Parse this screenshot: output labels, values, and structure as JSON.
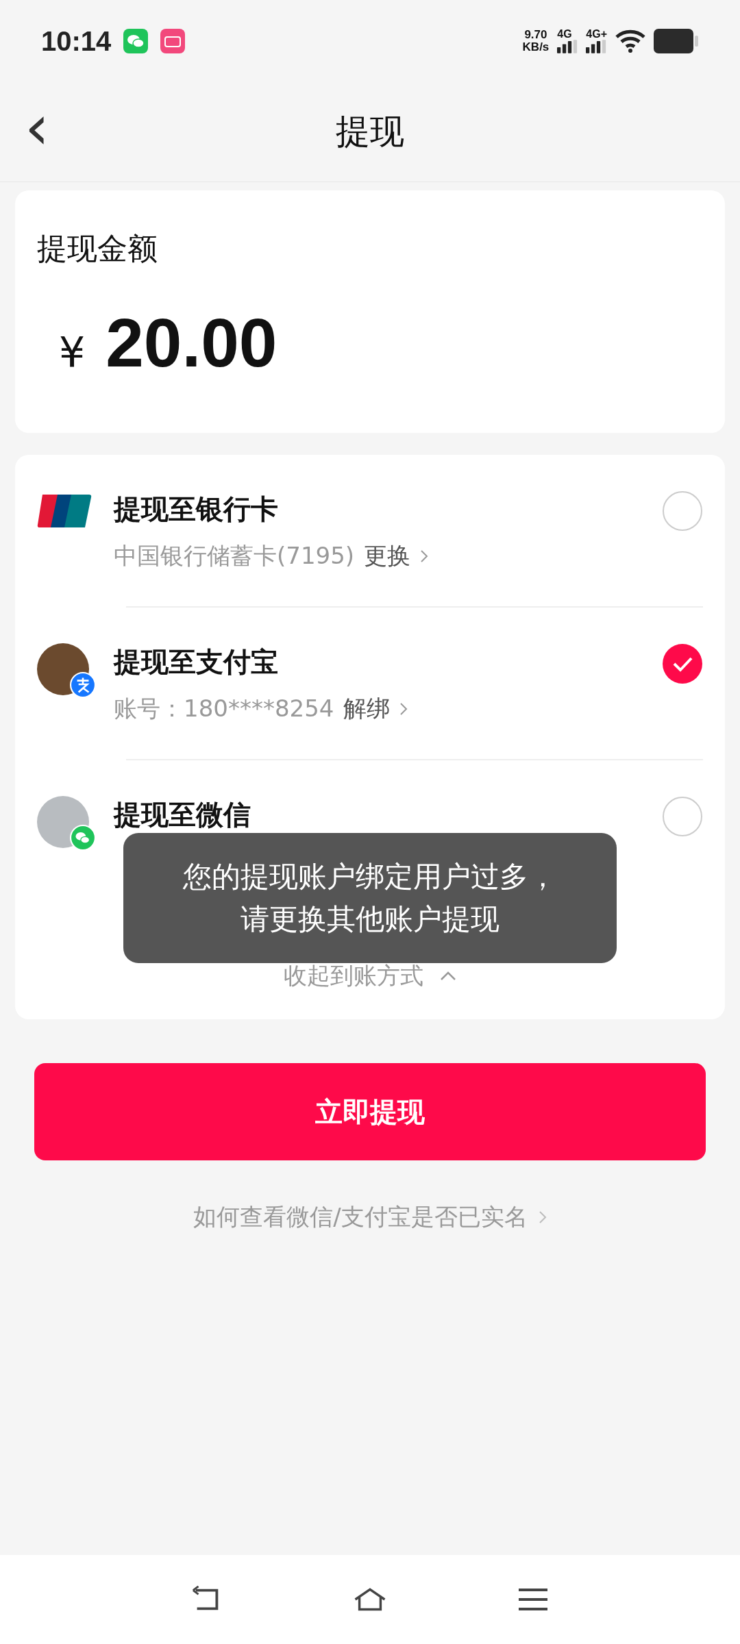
{
  "status_bar": {
    "time": "10:14",
    "speed_value": "9.70",
    "speed_unit": "KB/s",
    "sim_1": "4G",
    "sim_2": "4G+"
  },
  "header": {
    "back_icon": "‹",
    "title": "提现"
  },
  "amount_card": {
    "label": "提现金额",
    "currency": "¥",
    "amount": "20.00"
  },
  "methods": [
    {
      "kind": "bank",
      "title": "提现至银行卡",
      "detail": "中国银行储蓄卡(7195)",
      "action": "更换",
      "selected": false
    },
    {
      "kind": "alipay",
      "title": "提现至支付宝",
      "detail": "账号：180****8254",
      "action": "解绑",
      "selected": true
    },
    {
      "kind": "wechat",
      "title": "提现至微信",
      "selected": false
    }
  ],
  "collapse_link": "收起到账方式",
  "submit_button": "立即提现",
  "help_link": "如何查看微信/支付宝是否已实名",
  "toast": {
    "lines": [
      "您的提现账户绑定用户过多，",
      "请更换其他账户提现"
    ]
  }
}
